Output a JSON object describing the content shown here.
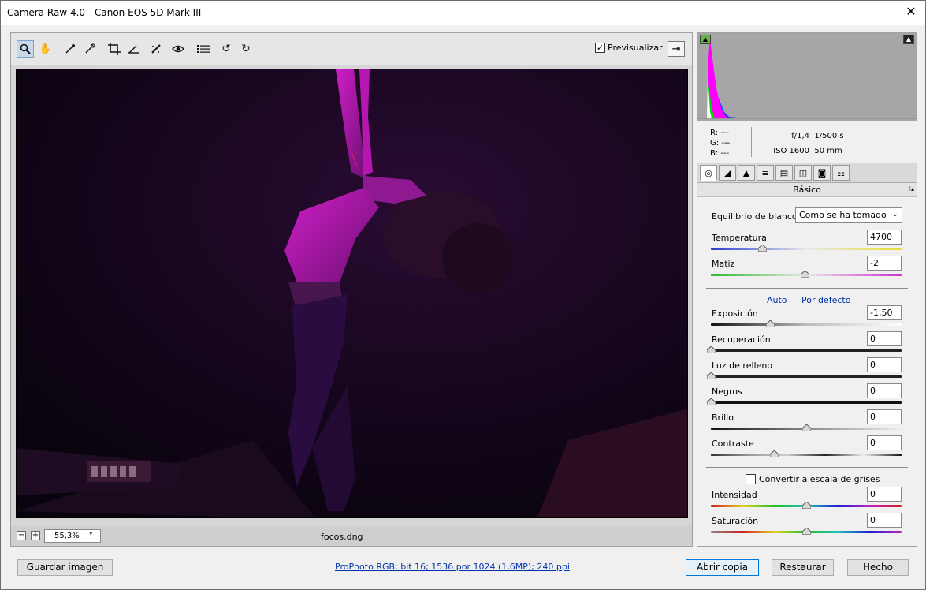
{
  "window": {
    "title": "Camera Raw 4.0 -  Canon EOS 5D Mark III",
    "close_glyph": "✕"
  },
  "toolbar": {
    "tools": [
      {
        "icon": "zoom-icon",
        "glyph": "🔍"
      },
      {
        "icon": "hand-icon",
        "glyph": "✋"
      },
      {
        "icon": "white-balance-icon",
        "glyph": "✒"
      },
      {
        "icon": "color-sampler-icon",
        "glyph": "✑"
      },
      {
        "icon": "crop-icon",
        "glyph": "⌗"
      },
      {
        "icon": "straighten-icon",
        "glyph": "⊿"
      },
      {
        "icon": "retouch-icon",
        "glyph": "✎"
      },
      {
        "icon": "red-eye-icon",
        "glyph": "◉"
      },
      {
        "icon": "preferences-icon",
        "glyph": "☰"
      },
      {
        "icon": "rotate-left-icon",
        "glyph": "↺"
      },
      {
        "icon": "rotate-right-icon",
        "glyph": "↻"
      }
    ],
    "preview_label": "Previsualizar",
    "preview_checked": true,
    "check_glyph": "✓",
    "fullscreen_glyph": "⇥"
  },
  "status": {
    "zoom_minus": "−",
    "zoom_plus": "+",
    "zoom_value": "55,3%",
    "zoom_arrow": "▾",
    "filename": "focos.dng"
  },
  "histogram": {
    "clip_shadow_glyph": "▲",
    "clip_highlight_glyph": "▲"
  },
  "info": {
    "r": "R:  ---",
    "g": "G:  ---",
    "b": "B:  ---",
    "aperture": "f/1,4",
    "shutter": "1/500 s",
    "iso": "ISO 1600",
    "focal": "50 mm"
  },
  "panel": {
    "tabs": [
      "basic-tab",
      "tone-curve-tab",
      "detail-tab",
      "hsl-tab",
      "split-toning-tab",
      "lens-tab",
      "camera-calibration-tab",
      "presets-tab"
    ],
    "tab_glyphs": [
      "◎",
      "◢",
      "▲",
      "≡",
      "▤",
      "◫",
      "◙",
      "☷"
    ],
    "section_title": "Básico",
    "section_menu_glyph": "⁝▴",
    "wb_label": "Equilibrio de blancos:",
    "wb_value": "Como se ha tomado",
    "wb_arrow": "⌄",
    "auto_label": "Auto",
    "default_label": "Por defecto",
    "grayscale_label": "Convertir a escala de grises",
    "grayscale_checked": false,
    "sliders": [
      {
        "label": "Temperatura",
        "value": "4700",
        "pos": 0.27
      },
      {
        "label": "Matiz",
        "value": "-2",
        "pos": 0.49
      },
      {
        "label": "Exposición",
        "value": "-1,50",
        "pos": 0.31
      },
      {
        "label": "Recuperación",
        "value": "0",
        "pos": 0.0
      },
      {
        "label": "Luz de relleno",
        "value": "0",
        "pos": 0.0
      },
      {
        "label": "Negros",
        "value": "0",
        "pos": 0.0
      },
      {
        "label": "Brillo",
        "value": "0",
        "pos": 0.5
      },
      {
        "label": "Contraste",
        "value": "0",
        "pos": 0.33
      },
      {
        "label": "Intensidad",
        "value": "0",
        "pos": 0.5
      },
      {
        "label": "Saturación",
        "value": "0",
        "pos": 0.5
      }
    ]
  },
  "footer": {
    "save_label": "Guardar imagen",
    "workflow_link": "ProPhoto RGB; bit 16; 1536 por 1024 (1,6MP); 240 ppi",
    "open_label": "Abrir copia",
    "reset_label": "Restaurar",
    "done_label": "Hecho"
  }
}
